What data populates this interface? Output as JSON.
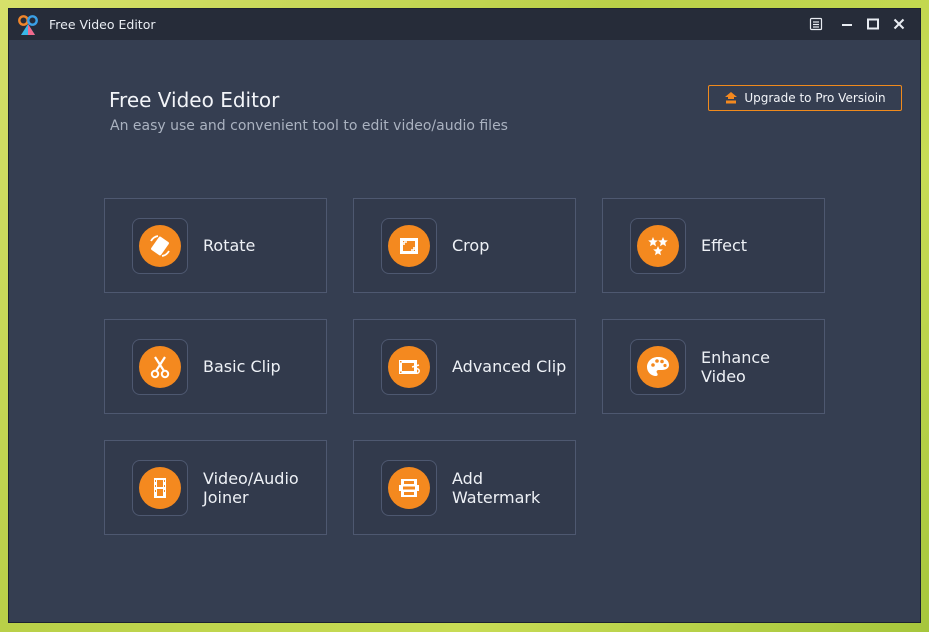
{
  "window": {
    "title": "Free Video Editor",
    "controls": [
      "menu-icon",
      "minimize-icon",
      "maximize-icon",
      "close-icon"
    ]
  },
  "header": {
    "title": "Free Video Editor",
    "subtitle": "An easy use and convenient tool to edit video/audio files"
  },
  "upgrade_button": {
    "label": "Upgrade to Pro Versioin",
    "icon": "upgrade-icon"
  },
  "colors": {
    "accent": "#f4891f",
    "background": "#353e51",
    "titlebar": "#262c39",
    "tile_border": "#4e5870"
  },
  "tools": [
    {
      "label": "Rotate",
      "icon": "rotate-icon"
    },
    {
      "label": "Crop",
      "icon": "crop-icon"
    },
    {
      "label": "Effect",
      "icon": "effect-stars-icon"
    },
    {
      "label": "Basic Clip",
      "icon": "scissors-icon"
    },
    {
      "label": "Advanced Clip",
      "icon": "film-scissors-icon"
    },
    {
      "label": "Enhance\nVideo",
      "icon": "palette-icon"
    },
    {
      "label": "Video/Audio\nJoiner",
      "icon": "film-strip-icon"
    },
    {
      "label": "Add\nWatermark",
      "icon": "watermark-icon"
    }
  ]
}
